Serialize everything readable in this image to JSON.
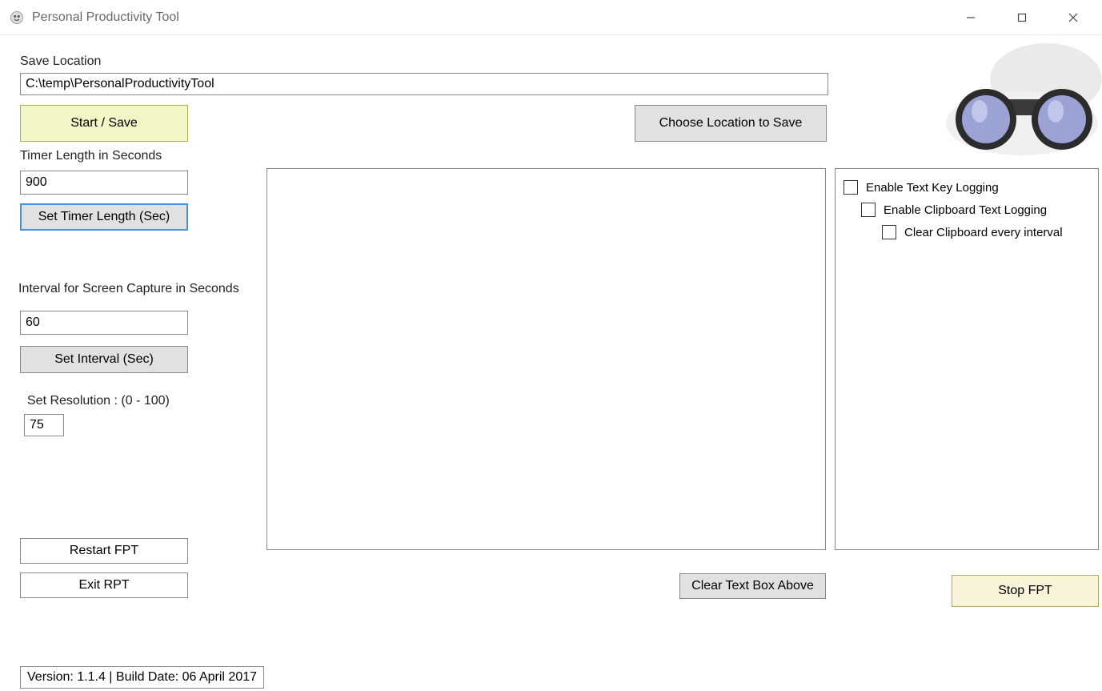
{
  "window": {
    "title": "Personal Productivity Tool"
  },
  "saveLocation": {
    "label": "Save Location",
    "value": "C:\\temp\\PersonalProductivityTool"
  },
  "buttons": {
    "startSave": "Start / Save",
    "chooseLocation": "Choose Location to Save",
    "setTimer": "Set Timer Length (Sec)",
    "setInterval": "Set Interval (Sec)",
    "restart": "Restart FPT",
    "exit": "Exit RPT",
    "clearTextbox": "Clear Text Box Above",
    "stop": "Stop FPT"
  },
  "timer": {
    "label": "Timer Length in Seconds",
    "value": "900"
  },
  "interval": {
    "label": "Interval for Screen Capture in Seconds",
    "value": "60"
  },
  "resolution": {
    "label": "Set Resolution : (0 - 100)",
    "value": "75"
  },
  "checkboxes": {
    "keyLogging": "Enable Text Key Logging",
    "clipboardLogging": "Enable Clipboard Text Logging",
    "clearClipboard": "Clear Clipboard every interval"
  },
  "status": {
    "version": "Version: 1.1.4  |  Build Date: 06 April 2017"
  }
}
